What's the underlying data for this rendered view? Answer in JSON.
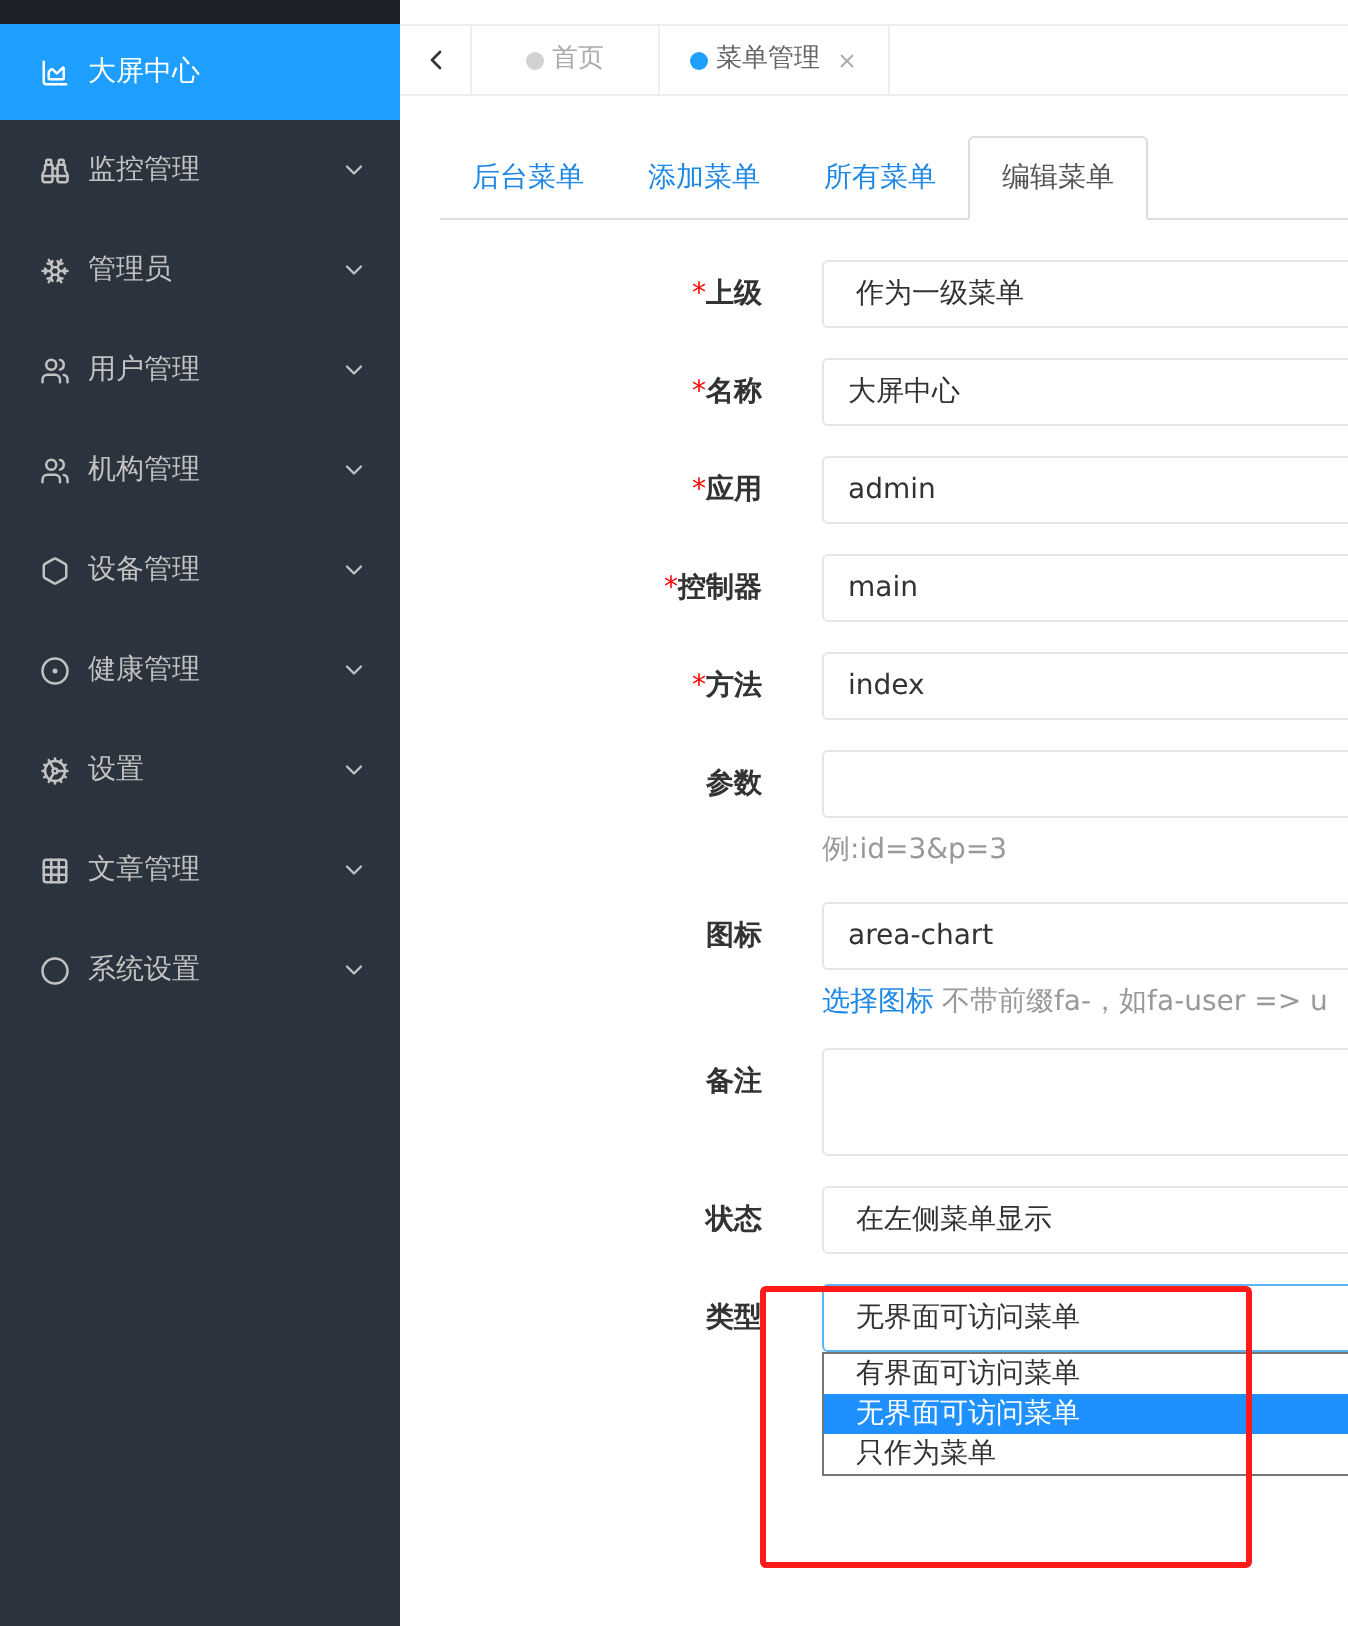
{
  "sidebar": {
    "items": [
      {
        "label": "大屏中心",
        "selected": true,
        "has_submenu": false
      },
      {
        "label": "监控管理",
        "selected": false,
        "has_submenu": true
      },
      {
        "label": "管理员",
        "selected": false,
        "has_submenu": true
      },
      {
        "label": "用户管理",
        "selected": false,
        "has_submenu": true
      },
      {
        "label": "机构管理",
        "selected": false,
        "has_submenu": true
      },
      {
        "label": "设备管理",
        "selected": false,
        "has_submenu": true
      },
      {
        "label": "健康管理",
        "selected": false,
        "has_submenu": true
      },
      {
        "label": "设置",
        "selected": false,
        "has_submenu": true
      },
      {
        "label": "文章管理",
        "selected": false,
        "has_submenu": true
      },
      {
        "label": "系统设置",
        "selected": false,
        "has_submenu": true
      }
    ]
  },
  "page_tabs": [
    {
      "label": "首页",
      "selected": false,
      "closable": false
    },
    {
      "label": "菜单管理",
      "selected": true,
      "closable": true
    }
  ],
  "content_tabs": [
    {
      "label": "后台菜单",
      "selected": false
    },
    {
      "label": "添加菜单",
      "selected": false
    },
    {
      "label": "所有菜单",
      "selected": false
    },
    {
      "label": "编辑菜单",
      "selected": true
    }
  ],
  "form": {
    "fields": [
      {
        "kind": "select",
        "required_mark": "*",
        "label": "上级",
        "value": "作为一级菜单"
      },
      {
        "kind": "text",
        "required_mark": "*",
        "label": "名称",
        "value": "大屏中心"
      },
      {
        "kind": "text",
        "required_mark": "*",
        "label": "应用",
        "value": "admin"
      },
      {
        "kind": "text",
        "required_mark": "*",
        "label": "控制器",
        "value": "main"
      },
      {
        "kind": "text",
        "required_mark": "*",
        "label": "方法",
        "value": "index"
      },
      {
        "kind": "text",
        "label": "参数",
        "help": "例:id=3&p=3"
      },
      {
        "kind": "text",
        "label": "图标",
        "value": "area-chart",
        "help_link": "选择图标",
        "help": "不带前缀fa-，如fa-user => u"
      },
      {
        "kind": "textarea",
        "label": "备注"
      },
      {
        "kind": "select",
        "label": "状态",
        "value": "在左侧菜单显示"
      },
      {
        "kind": "select",
        "label": "类型",
        "value": "无界面可访问菜单",
        "focused": true,
        "options": [
          {
            "label": "有界面可访问菜单",
            "selected": false
          },
          {
            "label": "无界面可访问菜单",
            "selected": true
          },
          {
            "label": "只作为菜单",
            "selected": false
          }
        ]
      }
    ]
  },
  "annotation": {
    "highlight": true
  }
}
